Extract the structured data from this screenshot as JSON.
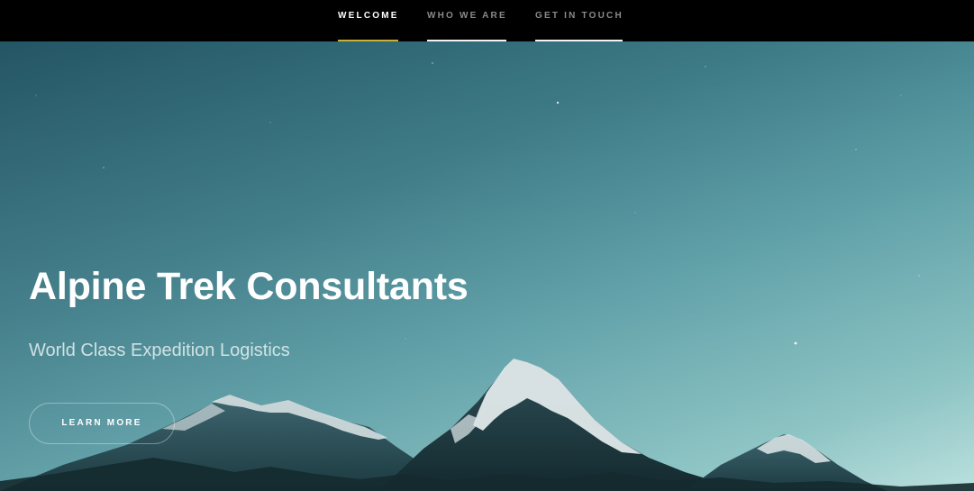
{
  "nav": {
    "items": [
      {
        "label": "WELCOME",
        "active": true
      },
      {
        "label": "WHO WE ARE",
        "active": false
      },
      {
        "label": "GET IN TOUCH",
        "active": false
      }
    ]
  },
  "hero": {
    "title": "Alpine Trek Consultants",
    "subtitle": "World Class Expedition Logistics",
    "cta_label": "LEARN MORE"
  },
  "colors": {
    "nav_background": "#000000",
    "active_underline": "#c9b037",
    "inactive_underline": "#f2f2f2",
    "sky_top": "#245564",
    "sky_bottom": "#b4dedb"
  }
}
